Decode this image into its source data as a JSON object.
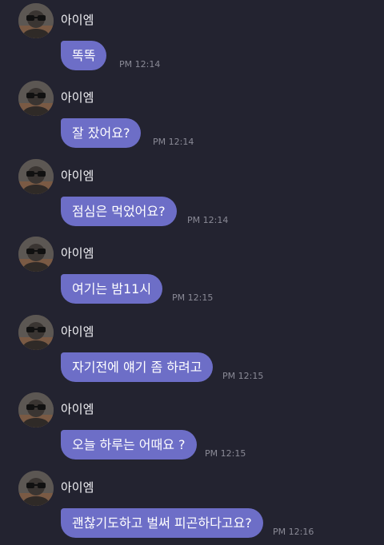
{
  "colors": {
    "background": "#232330",
    "bubble": "#6d6ec7",
    "sender_text": "#f2f2f6",
    "time_text": "#8a8a96"
  },
  "messages": [
    {
      "sender": "아이엠",
      "text": "똑똑",
      "time": "PM 12:14"
    },
    {
      "sender": "아이엠",
      "text": "잘 잤어요?",
      "time": "PM 12:14"
    },
    {
      "sender": "아이엠",
      "text": "점심은 먹었어요?",
      "time": "PM 12:14"
    },
    {
      "sender": "아이엠",
      "text": "여기는 밤11시",
      "time": "PM 12:15"
    },
    {
      "sender": "아이엠",
      "text": "자기전에 얘기 좀 하려고",
      "time": "PM 12:15"
    },
    {
      "sender": "아이엠",
      "text": "오늘 하루는 어때요 ?",
      "time": "PM 12:15"
    },
    {
      "sender": "아이엠",
      "text": "괜찮기도하고 벌써 피곤하다고요?",
      "time": "PM 12:16"
    }
  ]
}
